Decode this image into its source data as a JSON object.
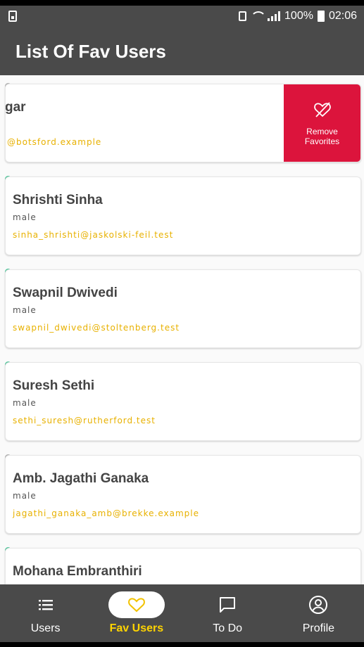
{
  "status_bar": {
    "battery_percent": "100%",
    "time": "02:06"
  },
  "app_bar": {
    "title": "List Of Fav Users"
  },
  "colors": {
    "bar": "#4a4a4a",
    "remove_action": "#dc143c",
    "email": "#e8b100",
    "active_nav_label": "#ffd400",
    "dot_online": "#4fc69a",
    "dot_offline": "#b0b0b0"
  },
  "users": [
    {
      "name": "gar",
      "gender": "",
      "email": "@botsford.example",
      "status": "offline",
      "swiped": true,
      "action_label_line1": "Remove",
      "action_label_line2": "Favorites",
      "action_icon": "heart-off-icon"
    },
    {
      "name": "Shrishti Sinha",
      "gender": "male",
      "email": "sinha_shrishti@jaskolski-feil.test",
      "status": "online"
    },
    {
      "name": "Swapnil Dwivedi",
      "gender": "male",
      "email": "swapnil_dwivedi@stoltenberg.test",
      "status": "online"
    },
    {
      "name": "Suresh Sethi",
      "gender": "male",
      "email": "sethi_suresh@rutherford.test",
      "status": "online"
    },
    {
      "name": "Amb. Jagathi Ganaka",
      "gender": "male",
      "email": "jagathi_ganaka_amb@brekke.example",
      "status": "offline"
    },
    {
      "name": "Mohana Embranthiri",
      "gender": "",
      "email": "",
      "status": "online"
    }
  ],
  "bottom_nav": {
    "items": [
      {
        "label": "Users",
        "icon": "list-icon",
        "active": false
      },
      {
        "label": "Fav Users",
        "icon": "heart-icon",
        "active": true
      },
      {
        "label": "To Do",
        "icon": "chat-icon",
        "active": false
      },
      {
        "label": "Profile",
        "icon": "account-circle-icon",
        "active": false
      }
    ]
  }
}
